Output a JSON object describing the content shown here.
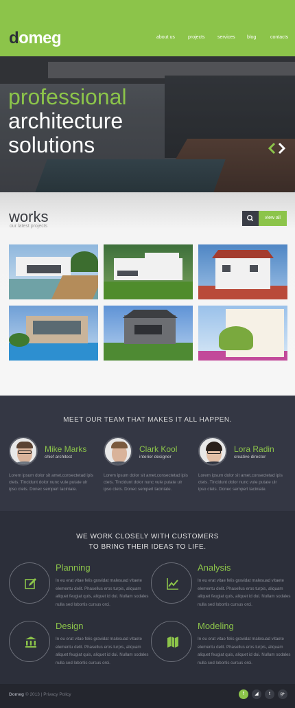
{
  "header": {
    "logo": "domeg",
    "nav": [
      "about us",
      "projects",
      "services",
      "blog",
      "contacts"
    ]
  },
  "hero": {
    "line1": "professional",
    "line2": "architecture",
    "line3": "solutions",
    "prev_icon": "chevron-left-icon",
    "next_icon": "chevron-right-icon"
  },
  "works": {
    "title": "works",
    "subtitle": "our latest projects",
    "search_icon": "search-icon",
    "view_all": "view all"
  },
  "team": {
    "heading": "MEET OUR TEAM THAT MAKES IT ALL HAPPEN.",
    "members": [
      {
        "name": "Mike Marks",
        "role": "chief architect",
        "text": "Lorem ipsum dolor sit amet,consectetad ipis ctets. Tincidunt dolor nunc vule putate ulr ipso ctets. Donec semperl taciniate."
      },
      {
        "name": "Clark Kool",
        "role": "interior designer",
        "text": "Lorem ipsum dolor sit amet,consectetad ipis ctets. Tincidunt dolor nunc vule putate ulr ipso ctets. Donec semperl taciniate."
      },
      {
        "name": "Lora Radin",
        "role": "creative director",
        "text": "Lorem ipsum dolor sit amet,consectetad ipis ctets. Tincidunt dolor nunc vule putate ulr ipso ctets. Donec semperl taciniate."
      }
    ]
  },
  "services": {
    "heading_line1": "WE WORK CLOSELY WITH CUSTOMERS",
    "heading_line2": "TO BRING THEIR IDEAS TO LIFE.",
    "items": [
      {
        "title": "Planning",
        "icon": "pencil-square-icon",
        "text": "In eu erat vitae felis gravidat malesuad vitaete elementu delit. Phasellus eros turpis, aliquam aliquet feugiat quis, aliquet id dui. Nullam sodales nulla sed lobortis cursus orci."
      },
      {
        "title": "Analysis",
        "icon": "line-chart-icon",
        "text": "In eu erat vitae felis gravidat malesuad vitaete elementu delit. Phasellus eros turpis, aliquam aliquet feugiat quis, aliquet id dui. Nullam sodales nulla sed lobortis cursus orci."
      },
      {
        "title": "Design",
        "icon": "institution-icon",
        "text": "In eu erat vitae felis gravidat malesuad vitaete elementu delit. Phasellus eros turpis, aliquam aliquet feugiat quis, aliquet id dui. Nullam sodales nulla sed lobortis cursus orci."
      },
      {
        "title": "Modeling",
        "icon": "map-icon",
        "text": "In eu erat vitae felis gravidat malesuad vitaete elementu delit. Phasellus eros turpis, aliquam aliquet feugiat quis, aliquet id dui. Nullam sodales nulla sed lobortis cursus orci."
      }
    ]
  },
  "footer": {
    "brand": "Domeg",
    "copy": "© 2013 | Privacy Policy",
    "social": [
      {
        "icon": "facebook-icon",
        "glyph": "f",
        "color": "#8cc44a"
      },
      {
        "icon": "rss-icon",
        "glyph": "◢",
        "color": "#3a3d46"
      },
      {
        "icon": "twitter-icon",
        "glyph": "t",
        "color": "#3a3d46"
      },
      {
        "icon": "google-plus-icon",
        "glyph": "g+",
        "color": "#3a3d46"
      }
    ]
  },
  "colors": {
    "accent": "#8cc44a",
    "dark": "#2c2f3a",
    "team_bg": "#343744"
  }
}
